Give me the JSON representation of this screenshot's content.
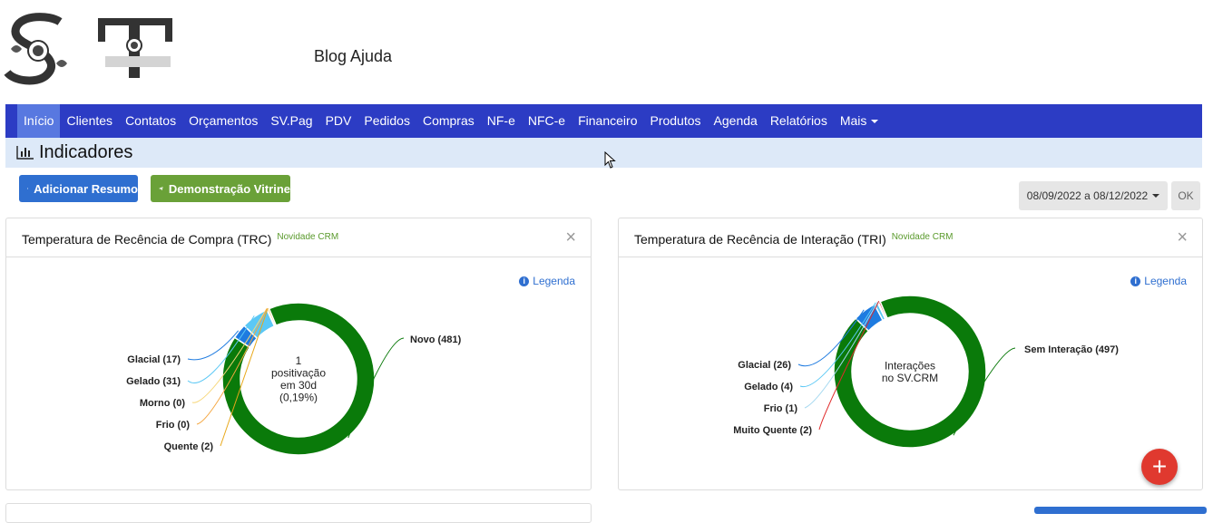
{
  "header": {
    "blog_link": "Blog Ajuda"
  },
  "nav": {
    "items": [
      "Início",
      "Clientes",
      "Contatos",
      "Orçamentos",
      "SV.Pag",
      "PDV",
      "Pedidos",
      "Compras",
      "NF-e",
      "NFC-e",
      "Financeiro",
      "Produtos",
      "Agenda",
      "Relatórios",
      "Mais"
    ],
    "active": "Início"
  },
  "page": {
    "title": "Indicadores"
  },
  "actions": {
    "add_summary": "Adicionar Resumo",
    "demo_showcase": "Demonstração Vitrine"
  },
  "date_filter": {
    "range": "08/09/2022 a 08/12/2022",
    "ok": "OK"
  },
  "panels": [
    {
      "title": "Temperatura de Recência de Compra (TRC)",
      "badge": "Novidade CRM",
      "legend_link": "Legenda",
      "center_lines": [
        "1",
        "positivação",
        "em 30d",
        "(0,19%)"
      ]
    },
    {
      "title": "Temperatura de Recência de Interação (TRI)",
      "badge": "Novidade CRM",
      "legend_link": "Legenda",
      "center_lines": [
        "Interações",
        "no SV.CRM"
      ]
    }
  ],
  "chart_data": [
    {
      "type": "pie",
      "categories": [
        "Novo",
        "Glacial",
        "Gelado",
        "Morno",
        "Frio",
        "Quente"
      ],
      "values": [
        481,
        17,
        31,
        0,
        0,
        2
      ],
      "labels": [
        "Novo (481)",
        "Glacial (17)",
        "Gelado (31)",
        "Morno (0)",
        "Frio (0)",
        "Quente (2)"
      ],
      "colors": [
        "#0a7a0a",
        "#1e7be0",
        "#5bc8f5",
        "#f7d77a",
        "#f4a640",
        "#e8a81a"
      ]
    },
    {
      "type": "pie",
      "categories": [
        "Sem Interação",
        "Glacial",
        "Gelado",
        "Frio",
        "Muito Quente"
      ],
      "values": [
        497,
        26,
        4,
        1,
        2
      ],
      "labels": [
        "Sem Interação (497)",
        "Glacial (26)",
        "Gelado (4)",
        "Frio (1)",
        "Muito Quente (2)"
      ],
      "colors": [
        "#0a7a0a",
        "#1e7be0",
        "#5bc8f5",
        "#a6d9f0",
        "#e02a2a"
      ]
    }
  ],
  "fab": {
    "label": "+"
  }
}
